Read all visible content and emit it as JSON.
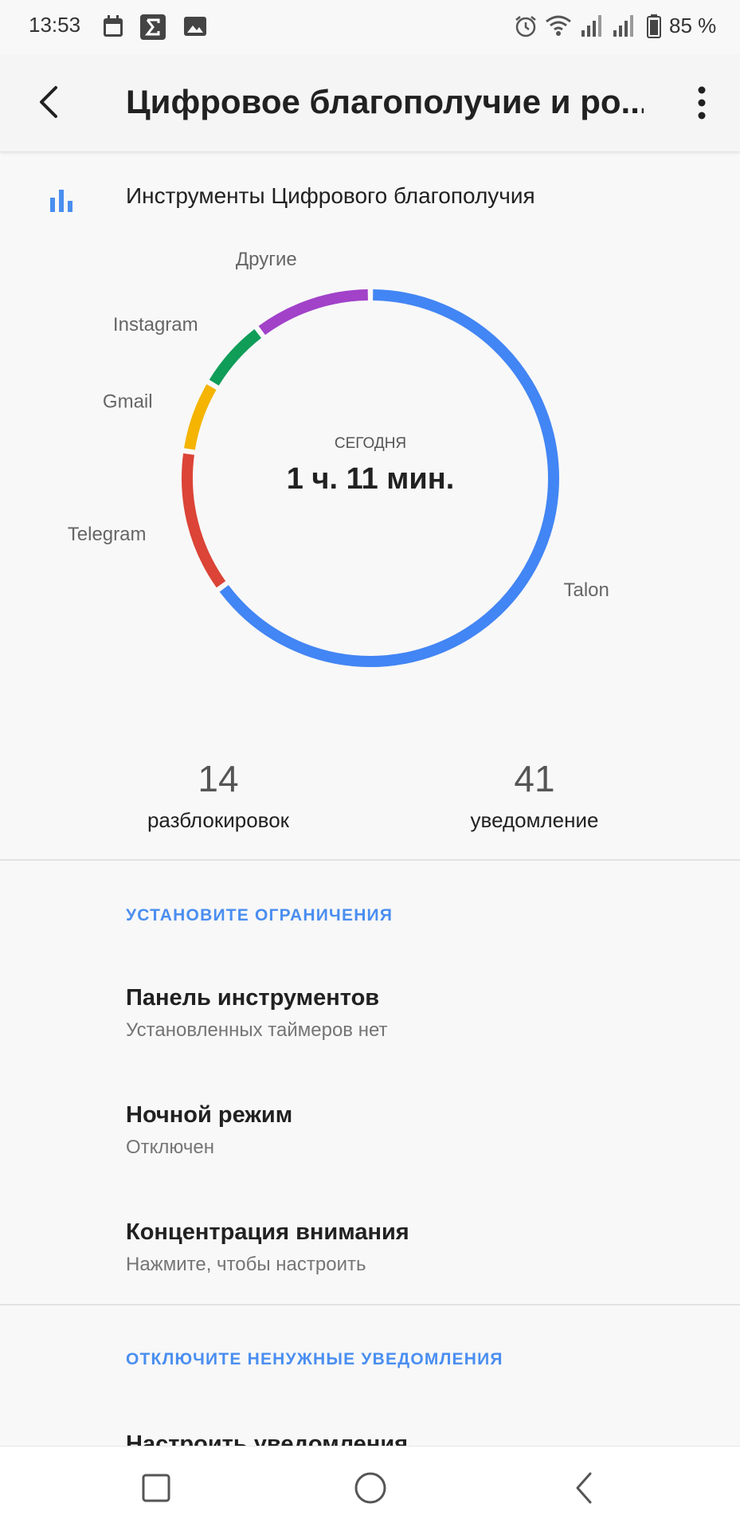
{
  "status_bar": {
    "time": "13:53",
    "battery": "85 %",
    "left_icons": [
      "calendar-icon",
      "sigma-icon",
      "image-icon"
    ],
    "right_icons": [
      "alarm-icon",
      "wifi-icon",
      "signal-icon",
      "signal-icon",
      "battery-icon"
    ]
  },
  "app_bar": {
    "title": "Цифровое благополучие и ро..."
  },
  "tools": {
    "title": "Инструменты Цифрового благополучия"
  },
  "chart_data": {
    "type": "pie",
    "center_label": "СЕГОДНЯ",
    "center_value": "1 ч. 11 мин.",
    "slices": [
      {
        "name": "Talon",
        "value": 63,
        "color": "#4285f4"
      },
      {
        "name": "Telegram",
        "value": 12,
        "color": "#db4437"
      },
      {
        "name": "Gmail",
        "value": 6,
        "color": "#f4b400"
      },
      {
        "name": "Instagram",
        "value": 6,
        "color": "#0f9d58"
      },
      {
        "name": "Другие",
        "value": 10,
        "color": "#a142c9"
      }
    ]
  },
  "stats": {
    "unlocks": {
      "value": "14",
      "label": "разблокировок"
    },
    "notifications": {
      "value": "41",
      "label": "уведомление"
    }
  },
  "limits": {
    "header": "УСТАНОВИТЕ ОГРАНИЧЕНИЯ",
    "items": [
      {
        "title": "Панель инструментов",
        "subtitle": "Установленных таймеров нет"
      },
      {
        "title": "Ночной режим",
        "subtitle": "Отключен"
      },
      {
        "title": "Концентрация внимания",
        "subtitle": "Нажмите, чтобы настроить"
      }
    ]
  },
  "notifications_section": {
    "header": "ОТКЛЮЧИТЕ НЕНУЖНЫЕ УВЕДОМЛЕНИЯ",
    "items": [
      {
        "title": "Настроить уведомления"
      }
    ]
  },
  "colors": {
    "accent": "#4a8ef0"
  }
}
